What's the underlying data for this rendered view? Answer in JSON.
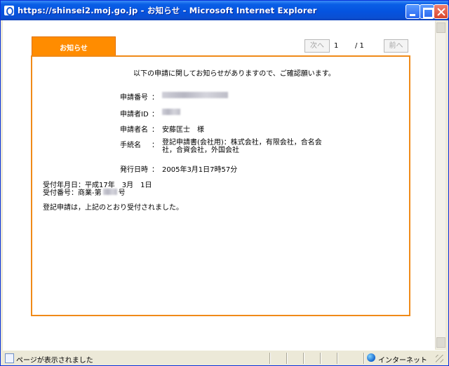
{
  "window": {
    "title": "https://shinsei2.moj.go.jp - お知らせ - Microsoft Internet Explorer",
    "title_icon": "ie-icon",
    "controls": [
      "minimize",
      "maximize",
      "close"
    ]
  },
  "tab": {
    "label": "お知らせ"
  },
  "pager": {
    "next_label": "次へ",
    "current_page": "1",
    "total_pages": "/ 1",
    "prev_label": "前へ"
  },
  "notice": {
    "intro": "以下の申請に関してお知らせがありますので、ご確認願います。",
    "fields": [
      {
        "label": "申請番号",
        "colon": "：",
        "value": ""
      },
      {
        "label": "申請者ID",
        "colon": "：",
        "value": ""
      },
      {
        "label": "申請者名",
        "colon": "：",
        "value": "安藤匡士　様"
      },
      {
        "label": "手続名",
        "colon": "：",
        "value": "登記申請書(会社用)：株式会社，有限会社，合名会社，合資会社，外国会社"
      },
      {
        "label": "発行日時",
        "colon": "：",
        "value": "2005年3月1日7時57分"
      }
    ],
    "receipt_date": "受付年月日：平成17年　3月　1日",
    "receipt_number_prefix": "受付番号：商業-第",
    "receipt_number_suffix": "号",
    "message": "登記申請は，上記のとおり受付されました。"
  },
  "statusbar": {
    "status_text": "ページが表示されました",
    "zone_text": "インターネット"
  },
  "colors": {
    "accent_orange": "#ff8c00",
    "panel_border": "#f08a18",
    "xp_titlebar": "#0553df"
  }
}
